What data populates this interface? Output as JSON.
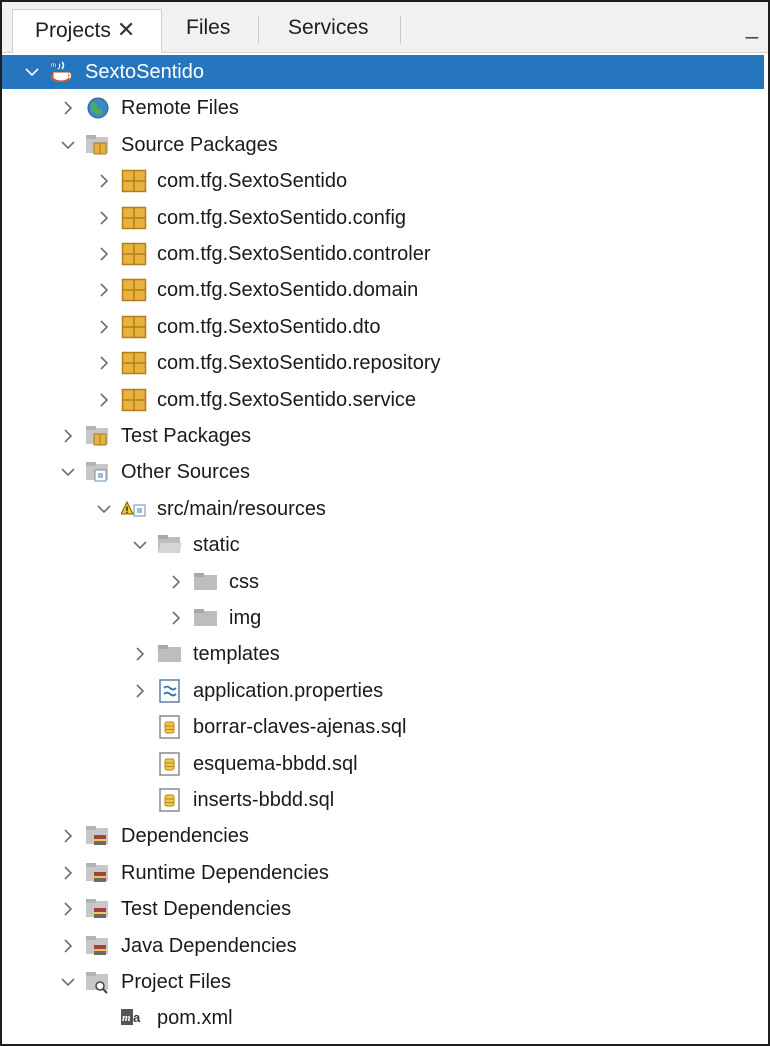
{
  "tabs": [
    {
      "label": "Projects"
    },
    {
      "label": "Files"
    },
    {
      "label": "Services"
    }
  ],
  "tab_close_glyph": "✕",
  "minimize_glyph": "_",
  "colors": {
    "selection": "#2675bf",
    "package": "#e8b23c",
    "folder": "#bdbdbd",
    "sql": "#f2c84b"
  },
  "tree": [
    {
      "label": "SextoSentido",
      "icon": "project-coffee-icon",
      "expanded": true,
      "selected": true
    },
    {
      "label": "Remote Files",
      "icon": "globe-icon",
      "expanded": false
    },
    {
      "label": "Source Packages",
      "icon": "source-packages-icon",
      "expanded": true
    },
    {
      "label": "com.tfg.SextoSentido",
      "icon": "package-icon",
      "expanded": false
    },
    {
      "label": "com.tfg.SextoSentido.config",
      "icon": "package-icon",
      "expanded": false
    },
    {
      "label": "com.tfg.SextoSentido.controler",
      "icon": "package-icon",
      "expanded": false
    },
    {
      "label": "com.tfg.SextoSentido.domain",
      "icon": "package-icon",
      "expanded": false
    },
    {
      "label": "com.tfg.SextoSentido.dto",
      "icon": "package-icon",
      "expanded": false
    },
    {
      "label": "com.tfg.SextoSentido.repository",
      "icon": "package-icon",
      "expanded": false
    },
    {
      "label": "com.tfg.SextoSentido.service",
      "icon": "package-icon",
      "expanded": false
    },
    {
      "label": "Test Packages",
      "icon": "test-packages-icon",
      "expanded": false
    },
    {
      "label": "Other Sources",
      "icon": "other-sources-icon",
      "expanded": true
    },
    {
      "label": "src/main/resources",
      "icon": "resources-folder-icon",
      "expanded": true
    },
    {
      "label": "static",
      "icon": "folder-open-icon",
      "expanded": true
    },
    {
      "label": "css",
      "icon": "folder-icon",
      "expanded": false
    },
    {
      "label": "img",
      "icon": "folder-icon",
      "expanded": false
    },
    {
      "label": "templates",
      "icon": "folder-icon",
      "expanded": false
    },
    {
      "label": "application.properties",
      "icon": "properties-file-icon",
      "expanded": false
    },
    {
      "label": "borrar-claves-ajenas.sql",
      "icon": "sql-file-icon"
    },
    {
      "label": "esquema-bbdd.sql",
      "icon": "sql-file-icon"
    },
    {
      "label": "inserts-bbdd.sql",
      "icon": "sql-file-icon"
    },
    {
      "label": "Dependencies",
      "icon": "dependencies-icon",
      "expanded": false
    },
    {
      "label": "Runtime Dependencies",
      "icon": "dependencies-icon",
      "expanded": false
    },
    {
      "label": "Test Dependencies",
      "icon": "dependencies-icon",
      "expanded": false
    },
    {
      "label": "Java Dependencies",
      "icon": "dependencies-icon",
      "expanded": false
    },
    {
      "label": "Project Files",
      "icon": "project-files-icon",
      "expanded": true
    },
    {
      "label": "pom.xml",
      "icon": "maven-pom-icon"
    }
  ]
}
